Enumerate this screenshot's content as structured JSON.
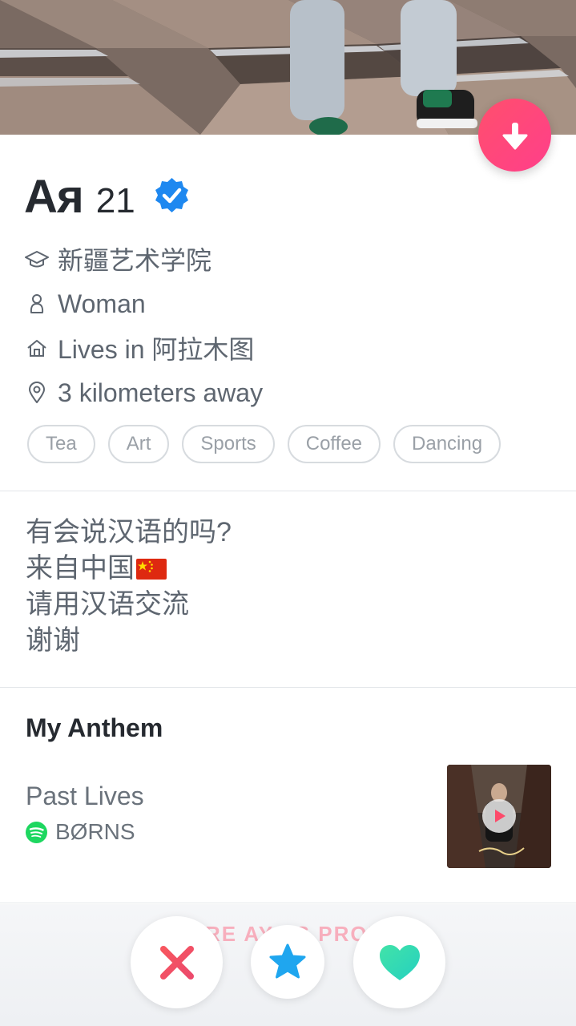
{
  "profile": {
    "name": "Ая",
    "age": "21",
    "school": "新疆艺术学院",
    "gender": "Woman",
    "lives_in": "Lives in 阿拉木图",
    "distance": "3 kilometers away",
    "interests": [
      "Tea",
      "Art",
      "Sports",
      "Coffee",
      "Dancing"
    ],
    "bio_lines": [
      "有会说汉语的吗?",
      "来自中国",
      "请用汉语交流",
      "谢谢"
    ]
  },
  "anthem": {
    "heading": "My Anthem",
    "song": "Past Lives",
    "artist": "BØRNS"
  },
  "share": {
    "label": "SHARE AYA'S PROFILE"
  },
  "icons": {
    "collapse": "arrow-down-icon",
    "verified": "verified-badge-icon",
    "school": "graduation-cap-icon",
    "gender": "person-icon",
    "home": "house-icon",
    "location": "location-pin-icon",
    "music": "spotify-icon",
    "play": "play-icon",
    "nope": "x-icon",
    "super_like": "star-icon",
    "like": "heart-icon"
  },
  "colors": {
    "brand_gradient_start": "#ff4f6d",
    "brand_gradient_end": "#ff3f8a",
    "verified_blue": "#1e88f0",
    "spotify_green": "#1ed760",
    "nope_red": "#f0505e",
    "super_like_blue": "#1fa6ef",
    "like_green": "#33dcb4"
  }
}
